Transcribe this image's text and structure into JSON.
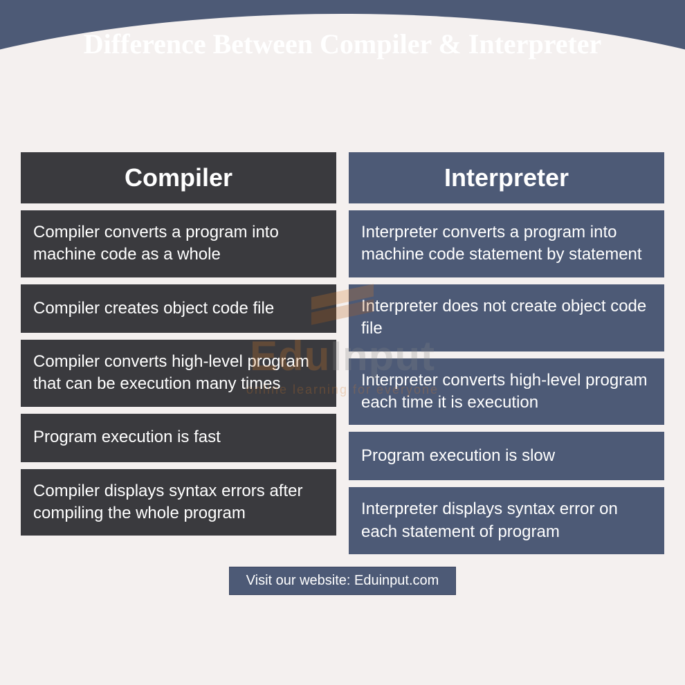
{
  "title": "Difference Between Compiler & Interpreter",
  "columns": {
    "left": {
      "header": "Compiler",
      "rows": [
        "Compiler converts a program into machine code as a whole",
        "Compiler creates object code file",
        "Compiler converts high-level program that can be execution many times",
        "Program execution is fast",
        "Compiler displays syntax errors after compiling the whole program"
      ]
    },
    "right": {
      "header": "Interpreter",
      "rows": [
        "Interpreter converts a program into machine code statement by statement",
        "Interpreter does not create object code file",
        "Interpreter converts high-level program each time it is execution",
        "Program execution is slow",
        "Interpreter displays syntax error on each statement of program"
      ]
    }
  },
  "footer": "Visit our website: Eduinput.com",
  "watermark": {
    "brand_part1": "Edu",
    "brand_part2": "Input",
    "tagline": "online learning for everyone"
  },
  "chart_data": {
    "type": "table",
    "title": "Difference Between Compiler & Interpreter",
    "columns": [
      "Compiler",
      "Interpreter"
    ],
    "rows": [
      [
        "Compiler converts a program into machine code as a whole",
        "Interpreter converts a program into machine code statement by statement"
      ],
      [
        "Compiler creates object code file",
        "Interpreter does not create object code file"
      ],
      [
        "Compiler converts high-level program that can be execution many times",
        "Interpreter converts high-level program each time it is execution"
      ],
      [
        "Program execution is fast",
        "Program execution is slow"
      ],
      [
        "Compiler displays syntax errors after compiling the whole program",
        "Interpreter displays syntax error on each statement of program"
      ]
    ]
  }
}
